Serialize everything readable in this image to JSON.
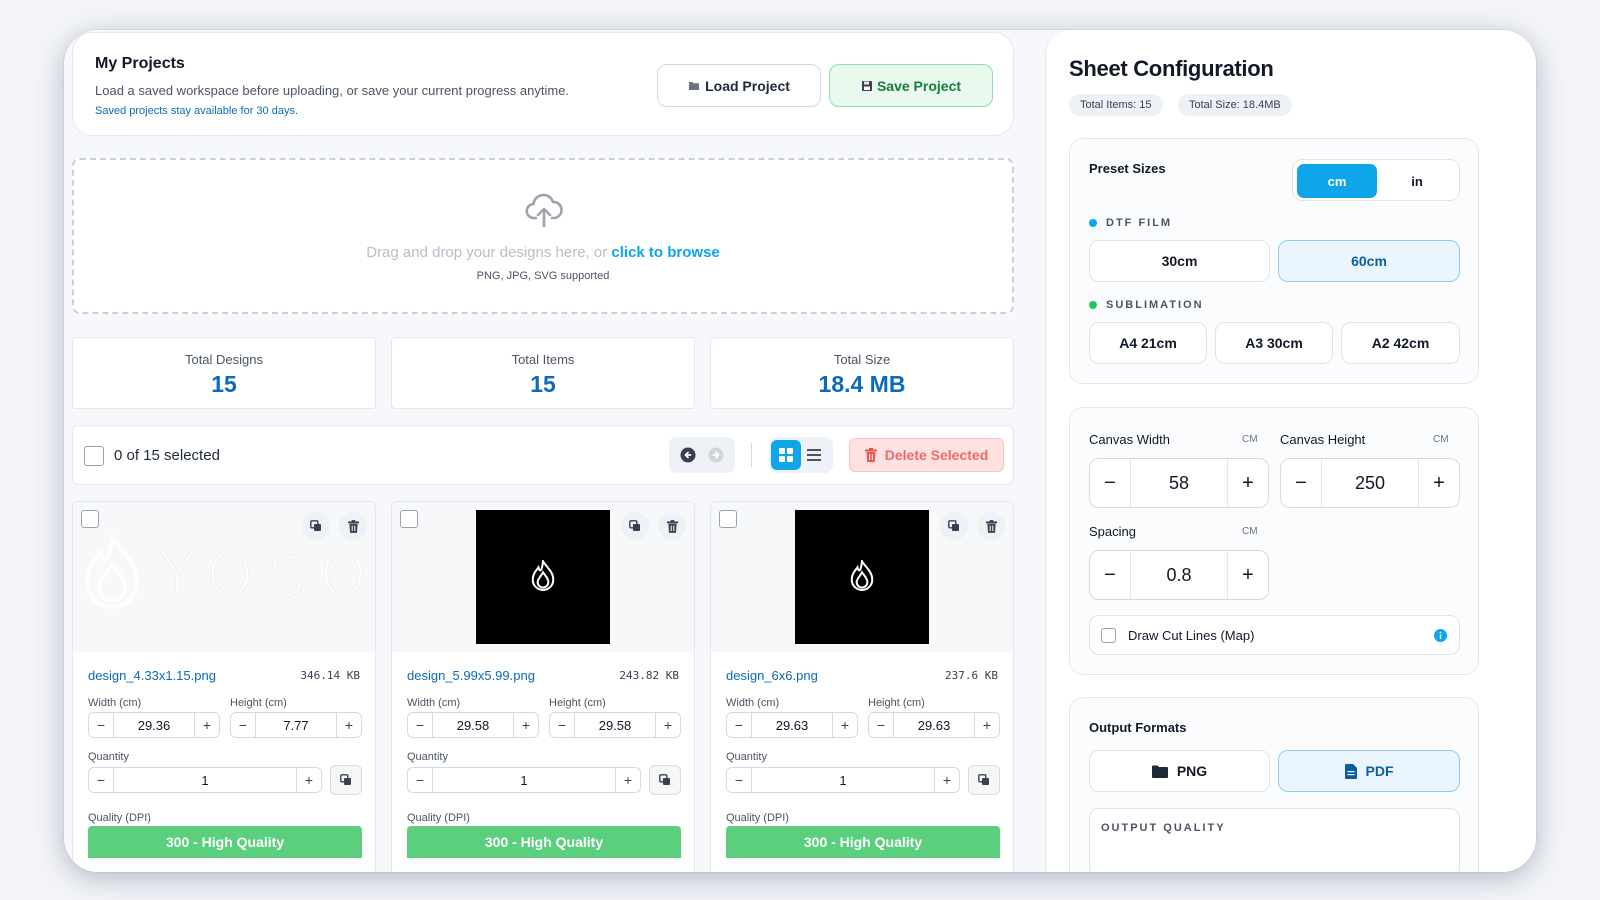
{
  "projects": {
    "title": "My Projects",
    "description": "Load a saved workspace before uploading, or save your current progress anytime.",
    "note": "Saved projects stay available for 30 days.",
    "load_label": "Load Project",
    "save_label": "Save Project"
  },
  "upload": {
    "prompt": "Drag and drop your designs here, or",
    "browse_link": "click to browse",
    "formats": "PNG, JPG, SVG supported"
  },
  "stats": [
    {
      "label": "Total Designs",
      "value": "15"
    },
    {
      "label": "Total Items",
      "value": "15"
    },
    {
      "label": "Total Size",
      "value": "18.4 MB"
    }
  ],
  "toolbar": {
    "selection": "0 of 15 selected",
    "delete_label": "Delete Selected"
  },
  "designs": [
    {
      "filename": "design_4.33x1.15.png",
      "size": "346.14 KB",
      "width_label": "Width (cm)",
      "height_label": "Height (cm)",
      "width": "29.36",
      "height": "7.77",
      "quantity_label": "Quantity",
      "quantity": "1",
      "quality_label": "Quality (DPI)",
      "quality": "300 - High Quality",
      "preview": "YOSO"
    },
    {
      "filename": "design_5.99x5.99.png",
      "size": "243.82 KB",
      "width_label": "Width (cm)",
      "height_label": "Height (cm)",
      "width": "29.58",
      "height": "29.58",
      "quantity_label": "Quantity",
      "quantity": "1",
      "quality_label": "Quality (DPI)",
      "quality": "300 - High Quality"
    },
    {
      "filename": "design_6x6.png",
      "size": "237.6 KB",
      "width_label": "Width (cm)",
      "height_label": "Height (cm)",
      "width": "29.63",
      "height": "29.63",
      "quantity_label": "Quantity",
      "quantity": "1",
      "quality_label": "Quality (DPI)",
      "quality": "300 - High Quality"
    }
  ],
  "sheet": {
    "title": "Sheet Configuration",
    "total_items": "Total Items: 15",
    "total_size": "Total Size: 18.4MB",
    "preset_title": "Preset Sizes",
    "unit_cm": "cm",
    "unit_in": "in",
    "dtf_label": "DTF FILM",
    "dtf_options": [
      "30cm",
      "60cm"
    ],
    "sub_label": "SUBLIMATION",
    "sub_options": [
      "A4 21cm",
      "A3 30cm",
      "A2 42cm"
    ],
    "canvas_width_label": "Canvas Width",
    "canvas_height_label": "Canvas Height",
    "unit_tag": "CM",
    "canvas_width": "58",
    "canvas_height": "250",
    "spacing_label": "Spacing",
    "spacing": "0.8",
    "cut_lines_label": "Draw Cut Lines (Map)",
    "output_title": "Output Formats",
    "format_png": "PNG",
    "format_pdf": "PDF",
    "output_quality_label": "OUTPUT QUALITY"
  },
  "colors": {
    "accent": "#0ea5e9",
    "link": "#0b6bb8",
    "green": "#5ccf7f",
    "danger_bg": "#fde0e0",
    "danger_text": "#ef4444"
  }
}
